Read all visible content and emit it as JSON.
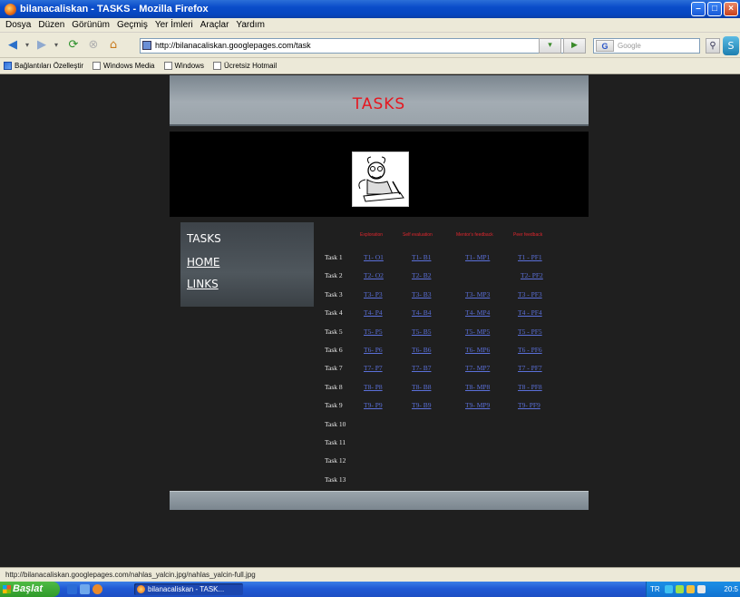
{
  "window": {
    "title": "bilanacaliskan - TASKS - Mozilla Firefox",
    "controls": [
      "minimize",
      "maximize",
      "close"
    ]
  },
  "menu": [
    "Dosya",
    "Düzen",
    "Görünüm",
    "Geçmiş",
    "Yer İmleri",
    "Araçlar",
    "Yardım"
  ],
  "toolbar": {
    "url": "http://bilanacaliskan.googlepages.com/task",
    "search_placeholder": "Google"
  },
  "bookmarks": [
    {
      "label": "Bağlantıları Özelleştir",
      "icon": "page-icon"
    },
    {
      "label": "Windows Media",
      "icon": "page-icon"
    },
    {
      "label": "Windows",
      "icon": "page-icon"
    },
    {
      "label": "Ücretsiz Hotmail",
      "icon": "page-icon"
    }
  ],
  "page": {
    "header_title": "TASKS",
    "sidebar": [
      {
        "label": "TASKS",
        "underline": false
      },
      {
        "label": "HOME",
        "underline": true
      },
      {
        "label": "LINKS",
        "underline": true
      }
    ],
    "columns": [
      "Exploration",
      "Self evaluation",
      "Mentor's feedback",
      "Peer feedback"
    ],
    "tasks": [
      {
        "label": "Task 1",
        "cells": [
          "T1- O1",
          "T1- B1",
          "T1- MP1",
          "T1 - PF1"
        ]
      },
      {
        "label": "Task 2",
        "cells": [
          "T2- O2",
          "T2- B2",
          "",
          "T2- PF2"
        ]
      },
      {
        "label": "Task 3",
        "cells": [
          "T3- P3",
          "T3- B3",
          "T3- MP3",
          "T3 - PF3"
        ]
      },
      {
        "label": "Task 4",
        "cells": [
          "T4- P4",
          "T4- B4",
          "T4- MP4",
          "T4 - PF4"
        ]
      },
      {
        "label": "Task 5",
        "cells": [
          "T5- P5",
          "T5- B5",
          "T5- MP5",
          "T5 - PF5"
        ]
      },
      {
        "label": "Task 6",
        "cells": [
          "T6- P6",
          "T6- B6",
          "T6- MP6",
          "T6 - PF6"
        ]
      },
      {
        "label": "Task 7",
        "cells": [
          "T7- P7",
          "T7- B7",
          "T7- MP7",
          "T7 - PF7"
        ]
      },
      {
        "label": "Task 8",
        "cells": [
          "T8- P8",
          "T8- B8",
          "T8- MP8",
          "T8 - PF8"
        ]
      },
      {
        "label": "Task 9",
        "cells": [
          "T9- P9",
          "T9- B9",
          "T9- MP9",
          "T9- PF9"
        ]
      },
      {
        "label": "Task 10",
        "cells": []
      },
      {
        "label": "Task 11",
        "cells": []
      },
      {
        "label": "Task 12",
        "cells": []
      },
      {
        "label": "Task 13",
        "cells": []
      }
    ]
  },
  "status_text": "http://bilanacaliskan.googlepages.com/nahlas_yalcin.jpg/nahlas_yalcin-full.jpg",
  "taskbar": {
    "start_label": "Başlat",
    "window_item": "bilanacaliskan - TASK...",
    "tray_lang": "TR",
    "clock": "20:5"
  },
  "colors": {
    "title_red": "#e6161f",
    "link_blue": "#5a6fd8",
    "column_head_red": "#e0262e",
    "page_bg": "#1f1f1f"
  }
}
